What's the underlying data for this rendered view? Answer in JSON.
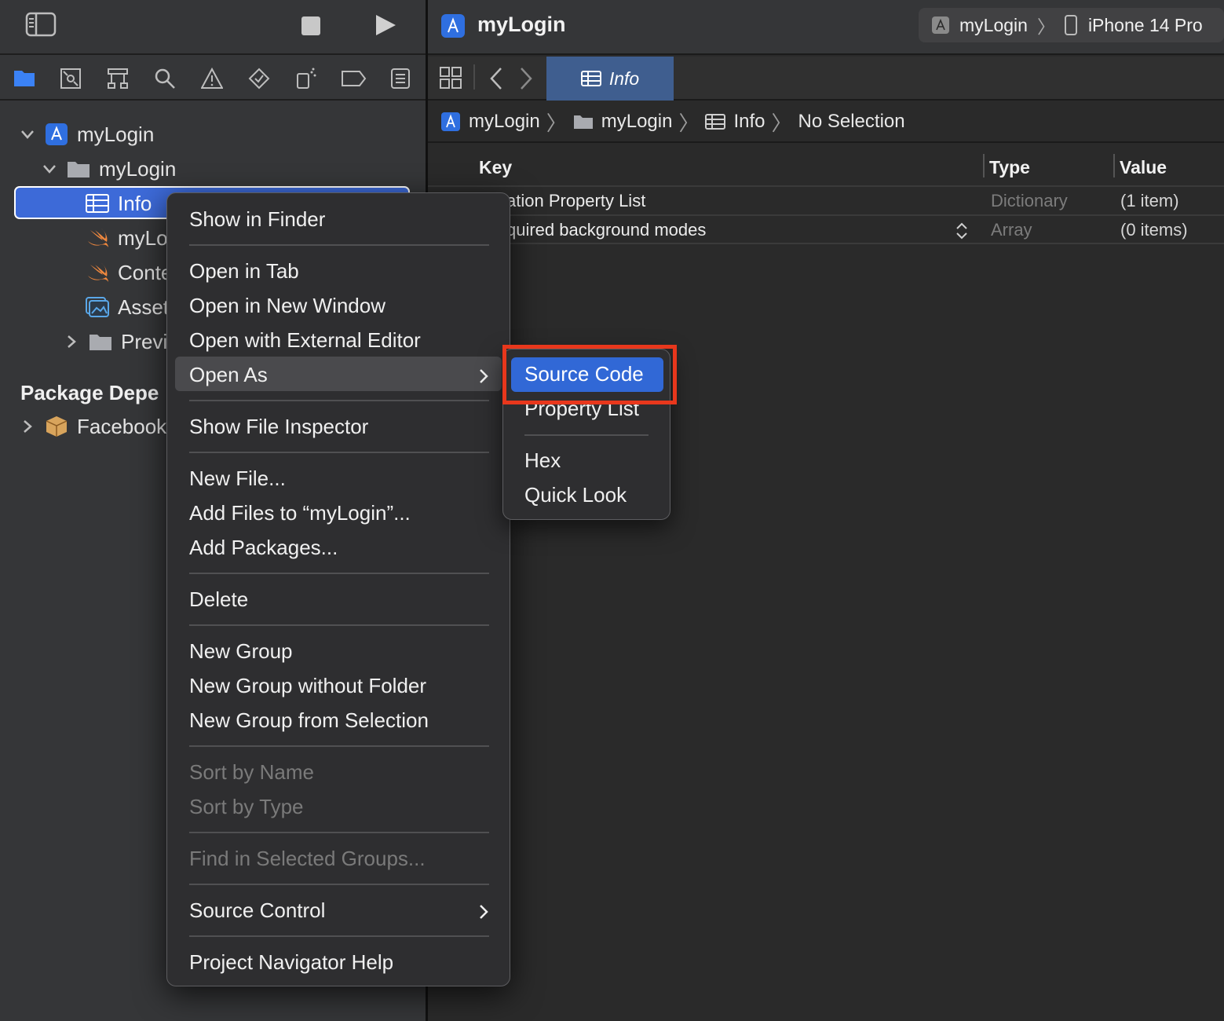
{
  "navigator": {
    "tree": {
      "project": "myLogin",
      "group": "myLogin",
      "selected_file": "Info",
      "file_1": "myLo",
      "file_2": "Conte",
      "file_3": "Asset",
      "folder": "Previ"
    },
    "package_section_title": "Package Depe",
    "package_item": "Facebook"
  },
  "editor": {
    "window_title": "myLogin",
    "scheme": {
      "target": "myLogin",
      "device": "iPhone 14 Pro"
    },
    "active_tab": "Info",
    "jumpbar": [
      "myLogin",
      "myLogin",
      "Info",
      "No Selection"
    ],
    "plist": {
      "headers": {
        "key": "Key",
        "type": "Type",
        "value": "Value"
      },
      "rows": [
        {
          "key": "ation Property List",
          "type": "Dictionary",
          "value": "(1 item)"
        },
        {
          "key": "quired background modes",
          "type": "Array",
          "value": "(0 items)"
        }
      ]
    }
  },
  "context_menu": {
    "show_in_finder": "Show in Finder",
    "open_in_tab": "Open in Tab",
    "open_in_new_window": "Open in New Window",
    "open_with_external_editor": "Open with External Editor",
    "open_as": "Open As",
    "show_file_inspector": "Show File Inspector",
    "new_file": "New File...",
    "add_files": "Add Files to “myLogin”...",
    "add_packages": "Add Packages...",
    "delete": "Delete",
    "new_group": "New Group",
    "new_group_without_folder": "New Group without Folder",
    "new_group_from_selection": "New Group from Selection",
    "sort_by_name": "Sort by Name",
    "sort_by_type": "Sort by Type",
    "find_in_selected_groups": "Find in Selected Groups...",
    "source_control": "Source Control",
    "project_navigator_help": "Project Navigator Help"
  },
  "open_as_submenu": {
    "source_code": "Source Code",
    "property_list": "Property List",
    "hex": "Hex",
    "quick_look": "Quick Look"
  },
  "colors": {
    "selection_blue": "#3d6ad8",
    "highlight_blue": "#3168d6",
    "annotation_red": "#e8371c",
    "swift_orange": "#f0883e"
  }
}
